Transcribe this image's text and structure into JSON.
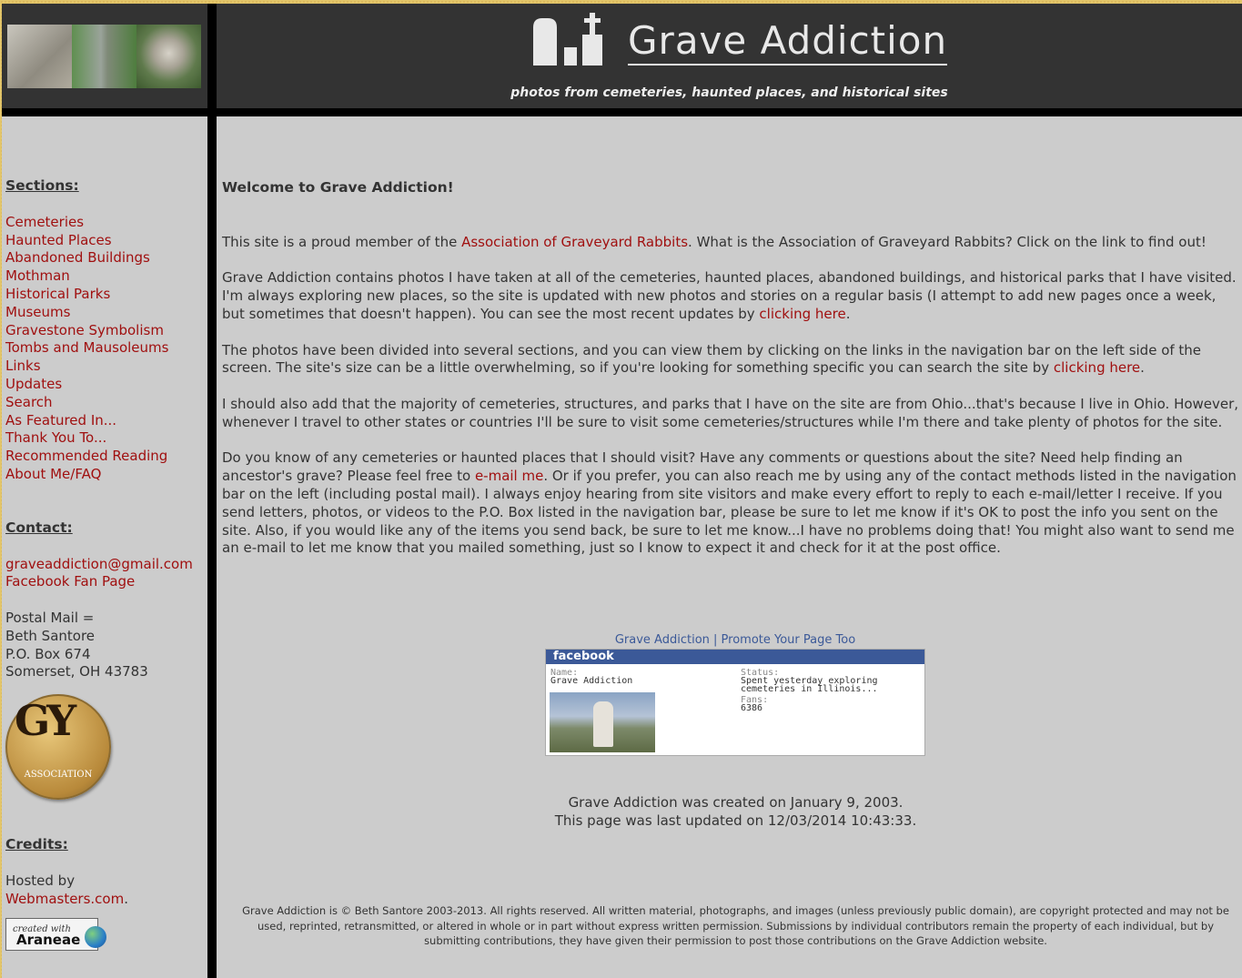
{
  "header": {
    "title": "Grave Addiction",
    "tagline": "photos from cemeteries, haunted places, and historical sites"
  },
  "sidebar": {
    "sections_heading": "Sections:",
    "sections": [
      "Cemeteries",
      "Haunted Places",
      "Abandoned Buildings",
      "Mothman",
      "Historical Parks",
      "Museums",
      "Gravestone Symbolism",
      "Tombs and Mausoleums",
      "Links",
      "Updates",
      "Search",
      "As Featured In...",
      "Thank You To...",
      "Recommended Reading",
      "About Me/FAQ"
    ],
    "contact_heading": "Contact:",
    "email": "graveaddiction@gmail.com",
    "facebook": "Facebook Fan Page",
    "postal_label": "Postal Mail =",
    "postal_name": "Beth Santore",
    "postal_box": "P.O. Box 674",
    "postal_city": "Somerset, OH 43783",
    "badge_letters": "GY",
    "badge_text": "ASSOCIATION",
    "credits_heading": "Credits:",
    "hosted_by": "Hosted by",
    "host_link": "Webmasters.com",
    "host_suffix": ".",
    "araneae_small": "created with",
    "araneae_name": "Araneae"
  },
  "main": {
    "welcome": "Welcome to Grave Addiction!",
    "p1_before": "This site is a proud member of the ",
    "p1_link": "Association of Graveyard Rabbits",
    "p1_after": ". What is the Association of Graveyard Rabbits? Click on the link to find out!",
    "p2_before": "Grave Addiction contains photos I have taken at all of the cemeteries, haunted places, abandoned buildings, and historical parks that I have visited. I'm always exploring new places, so the site is updated with new photos and stories on a regular basis (I attempt to add new pages once a week, but sometimes that doesn't happen). You can see the most recent updates by ",
    "p2_link": "clicking here",
    "p2_after": ".",
    "p3_before": "The photos have been divided into several sections, and you can view them by clicking on the links in the navigation bar on the left side of the screen. The site's size can be a little overwhelming, so if you're looking for something specific you can search the site by ",
    "p3_link": "clicking here",
    "p3_after": ".",
    "p4": "I should also add that the majority of cemeteries, structures, and parks that I have on the site are from Ohio...that's because I live in Ohio. However, whenever I travel to other states or countries I'll be sure to visit some cemeteries/structures while I'm there and take plenty of photos for the site.",
    "p5_before": "Do you know of any cemeteries or haunted places that I should visit? Have any comments or questions about the site? Need help finding an ancestor's grave? Please feel free to ",
    "p5_link": "e-mail me",
    "p5_after": ". Or if you prefer, you can also reach me by using any of the contact methods listed in the navigation bar on the left (including postal mail). I always enjoy hearing from site visitors and make every effort to reply to each e-mail/letter I receive. If you send letters, photos, or videos to the P.O. Box listed in the navigation bar, please be sure to let me know if it's OK to post the info you sent on the site. Also, if you would like any of the items you send back, be sure to let me know...I have no problems doing that! You might also want to send me an e-mail to let me know that you mailed something, just so I know to expect it and check for it at the post office."
  },
  "facebook_badge": {
    "top_link1": "Grave Addiction",
    "top_sep": " | ",
    "top_link2": "Promote Your Page Too",
    "bar": "facebook",
    "name_label": "Name:",
    "name_value": "Grave Addiction",
    "status_label": "Status:",
    "status_value": "Spent yesterday exploring cemeteries in Illinois...",
    "fans_label": "Fans:",
    "fans_value": "6386"
  },
  "created": {
    "line1": "Grave Addiction was created on January 9, 2003.",
    "line2": "This page was last updated on 12/03/2014 10:43:33."
  },
  "footer": {
    "text": "Grave Addiction is © Beth Santore 2003-2013. All rights reserved. All written material, photographs, and images (unless previously public domain), are copyright protected and may not be used, reprinted, retransmitted, or altered in whole or in part without express written permission. Submissions by individual contributors remain the property of each individual, but by submitting contributions, they have given their permission to post those contributions on the Grave Addiction website."
  }
}
